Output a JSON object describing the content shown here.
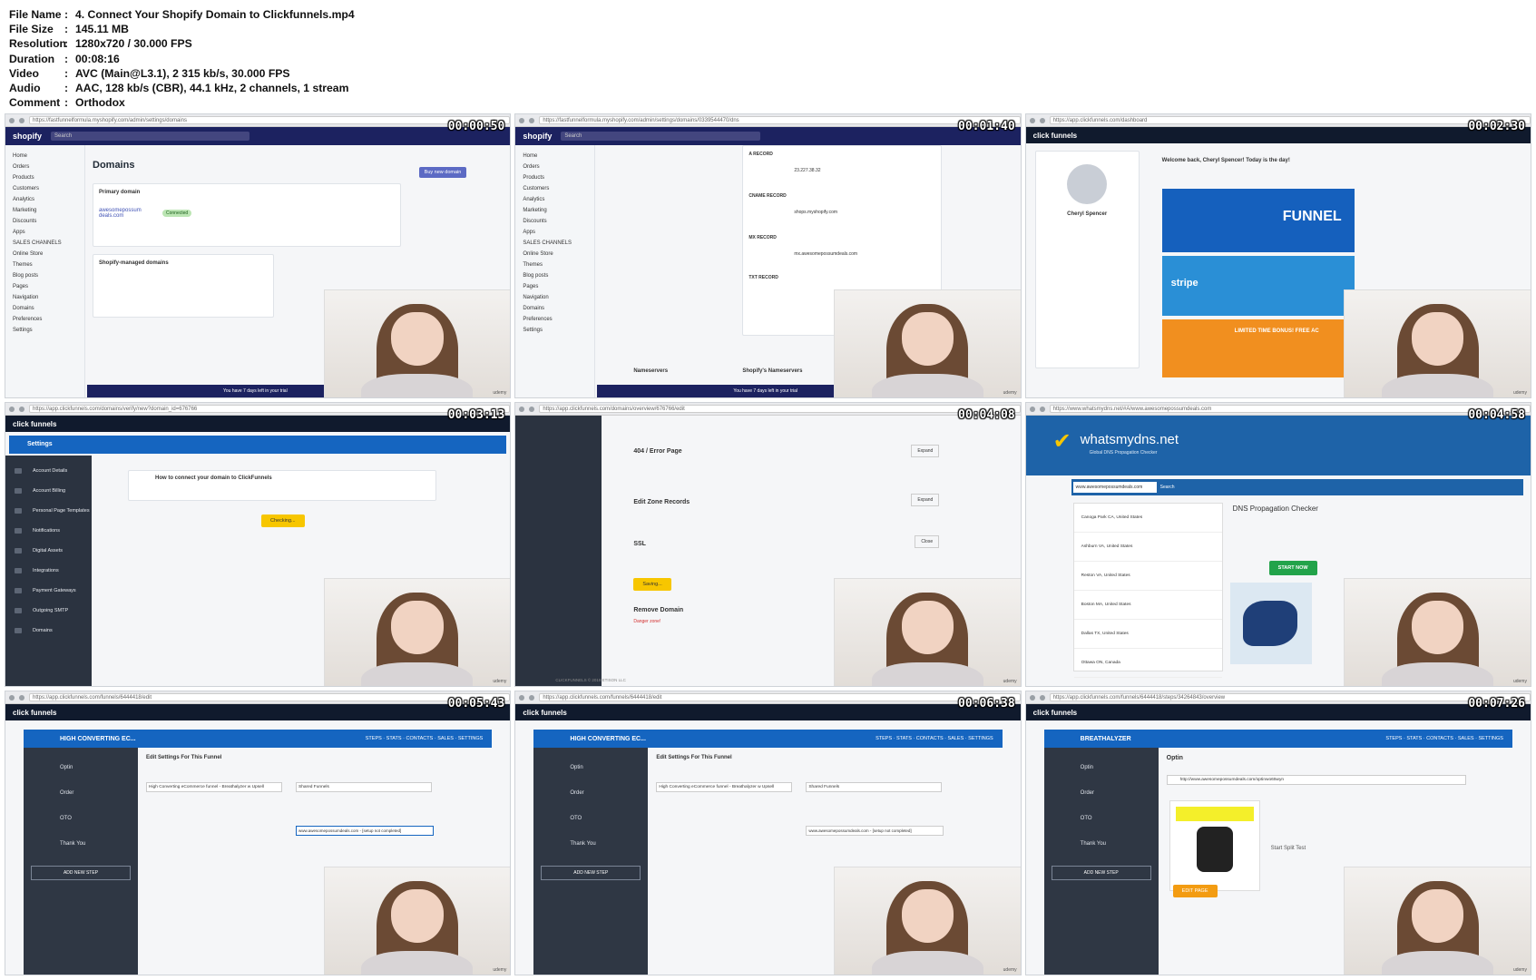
{
  "meta": {
    "rows": [
      {
        "key": "File Name",
        "value": "4. Connect Your Shopify Domain to Clickfunnels.mp4"
      },
      {
        "key": "File Size",
        "value": "145.11 MB"
      },
      {
        "key": "Resolution",
        "value": "1280x720 / 30.000 FPS"
      },
      {
        "key": "Duration",
        "value": "00:08:16"
      },
      {
        "key": "Video",
        "value": "AVC (Main@L3.1), 2 315 kb/s, 30.000 FPS"
      },
      {
        "key": "Audio",
        "value": "AAC, 128 kb/s (CBR), 44.1 kHz, 2 channels, 1 stream"
      },
      {
        "key": "Comment",
        "value": "Orthodox"
      }
    ]
  },
  "thumbs": [
    {
      "timestamp": "00:00:50",
      "url": "https://fastfunnelformula.myshopify.com/admin/settings/domains",
      "app": "shopify",
      "page_title": "Domains",
      "search": "Search",
      "sidebar": [
        "Home",
        "Orders",
        "Products",
        "Customers",
        "Analytics",
        "Marketing",
        "Discounts",
        "Apps",
        "SALES CHANNELS",
        "Online Store",
        "Themes",
        "Blog posts",
        "Pages",
        "Navigation",
        "Domains",
        "Preferences",
        "Settings"
      ],
      "primary_domain_label": "Primary domain",
      "primary_domain": "awesomepossum deals.com",
      "status": "Connected",
      "buy_button": "Buy new domain",
      "managed_label": "Shopify-managed domains",
      "trial": "You have 7 days left in your trial"
    },
    {
      "timestamp": "00:01:40",
      "url": "https://fastfunnelformula.myshopify.com/admin/settings/domains/0339544470/dns",
      "app": "shopify",
      "a_record": "A RECORD",
      "a_points": "23.227.38.32",
      "cname_record": "CNAME RECORD",
      "cname_points": "shops.myshopify.com",
      "mx_record": "MX RECORD",
      "mx_points": "mx.awesomepossumdeals.com",
      "txt_record": "TXT RECORD",
      "nameservers": "Nameservers",
      "shopify_ns": "Shopify's Nameservers",
      "trial": "You have 7 days left in your trial"
    },
    {
      "timestamp": "00:02:30",
      "url": "https://app.clickfunnels.com/dashboard",
      "app": "clickfunnels",
      "welcome": "Welcome back, Cheryl Spencer! Today is the day!",
      "user": "Cheryl Spencer",
      "banner_1": "FUNNEL",
      "banner_2": "stripe",
      "banner_3": "LIMITED TIME BONUS! FREE AC"
    },
    {
      "timestamp": "00:03:13",
      "url": "https://app.clickfunnels.com/domains/verify/new?domain_id=676766",
      "app": "clickfunnels",
      "settings": "Settings",
      "how_to": "How to connect your domain to ClickFunnels",
      "checking": "Checking...",
      "menu": [
        "Account Details",
        "Account Billing",
        "Personal Page Templates",
        "Notifications",
        "Digital Assets",
        "Integrations",
        "Payment Gateways",
        "Outgoing SMTP",
        "Domains"
      ]
    },
    {
      "timestamp": "00:04:08",
      "url": "https://app.clickfunnels.com/domains/overview/676766/edit",
      "app": "clickfunnels",
      "error_page": "404 / Error Page",
      "edit_zone": "Edit Zone Records",
      "ssl": "SSL",
      "remove": "Remove Domain",
      "danger": "Danger zone!",
      "expand": "Expand",
      "close": "Close",
      "saving": "Saving...",
      "footer": "CLICKFUNNELS © 2019 ETISON LLC"
    },
    {
      "timestamp": "00:04:58",
      "url": "https://www.whatsmydns.net/#A/www.awesomepossumdeals.com",
      "app": "whatsmydns",
      "site": "whatsmydns.net",
      "site_sub": "Global DNS Propagation Checker",
      "query": "www.awesomepossumdeals.com",
      "search": "Search",
      "heading": "DNS Propagation Checker",
      "start": "START NOW",
      "locations": [
        "Canoga Park CA, United States",
        "Ashburn VA, United States",
        "Reston VA, United States",
        "Boston MA, United States",
        "Dallas TX, United States",
        "Ottawa ON, Canada"
      ]
    },
    {
      "timestamp": "00:05:43",
      "url": "https://app.clickfunnels.com/funnels/6444418/edit",
      "app": "clickfunnels",
      "funnel": "HIGH CONVERTING EC...",
      "section": "Edit Settings For This Funnel",
      "name_value": "High Converting eCommerce funnel - Breathalyzer w Upsell",
      "group_tag": "Shared Funnels",
      "domain": "www.awesomepossumdeals.com - [setup not completed]",
      "steps": [
        "Optin",
        "Order",
        "OTO",
        "Thank You"
      ],
      "add_step": "ADD NEW STEP"
    },
    {
      "timestamp": "00:06:38",
      "url": "https://app.clickfunnels.com/funnels/6444418/edit",
      "app": "clickfunnels",
      "funnel": "HIGH CONVERTING EC...",
      "section": "Edit Settings For This Funnel",
      "name_value": "High Converting eCommerce funnel - Breathalyzer w Upsell",
      "group_tag": "Shared Funnels",
      "domain": "www.awesomepossumdeals.com - [setup not completed]",
      "steps": [
        "Optin",
        "Order",
        "OTO",
        "Thank You"
      ],
      "add_step": "ADD NEW STEP"
    },
    {
      "timestamp": "00:07:26",
      "url": "https://app.clickfunnels.com/funnels/6444418/steps/34264843/overview",
      "app": "clickfunnels",
      "funnel": "BREATHALYZER",
      "step": "Optin",
      "page_url": "http://www.awesomepossumdeals.com/optinwo65wyn",
      "split": "Start Split Test",
      "edit_page": "EDIT PAGE",
      "steps": [
        "Optin",
        "Order",
        "OTO",
        "Thank You"
      ],
      "add_step": "ADD NEW STEP"
    }
  ]
}
